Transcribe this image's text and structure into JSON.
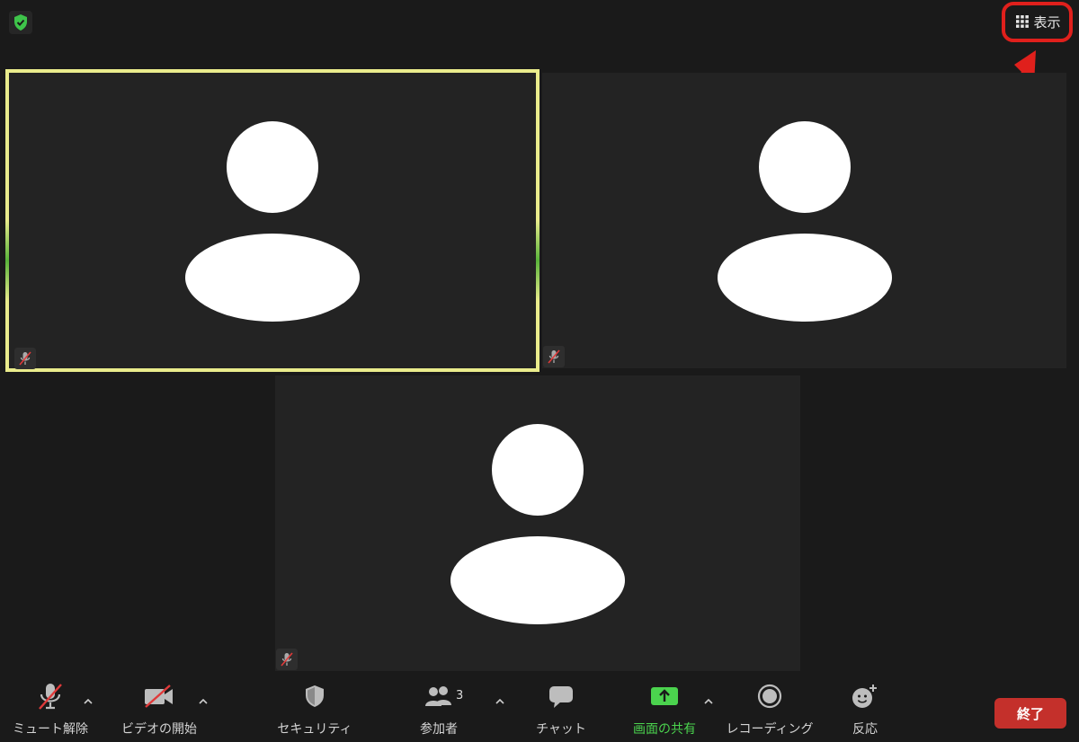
{
  "header": {
    "view_label": "表示",
    "icons": {
      "security_status": "shield-check-icon",
      "view": "grid-icon"
    }
  },
  "participants": [
    {
      "id": 1,
      "muted": true,
      "active_speaker": true,
      "avatar": "person-silhouette-icon"
    },
    {
      "id": 2,
      "muted": true,
      "active_speaker": false,
      "avatar": "person-silhouette-icon"
    },
    {
      "id": 3,
      "muted": true,
      "active_speaker": false,
      "avatar": "person-silhouette-icon"
    }
  ],
  "toolbar": {
    "unmute_label": "ミュート解除",
    "start_video_label": "ビデオの開始",
    "security_label": "セキュリティ",
    "participants_label": "参加者",
    "participants_count": "3",
    "chat_label": "チャット",
    "share_screen_label": "画面の共有",
    "recording_label": "レコーディング",
    "reactions_label": "反応",
    "end_label": "終了"
  },
  "colors": {
    "background": "#1a1a1a",
    "tile": "#232323",
    "active_border": "#eaec8c",
    "share_green": "#4bd34e",
    "end_red": "#c4302b",
    "mute_red": "#e03a3a",
    "annotation_red": "#e0201c"
  }
}
